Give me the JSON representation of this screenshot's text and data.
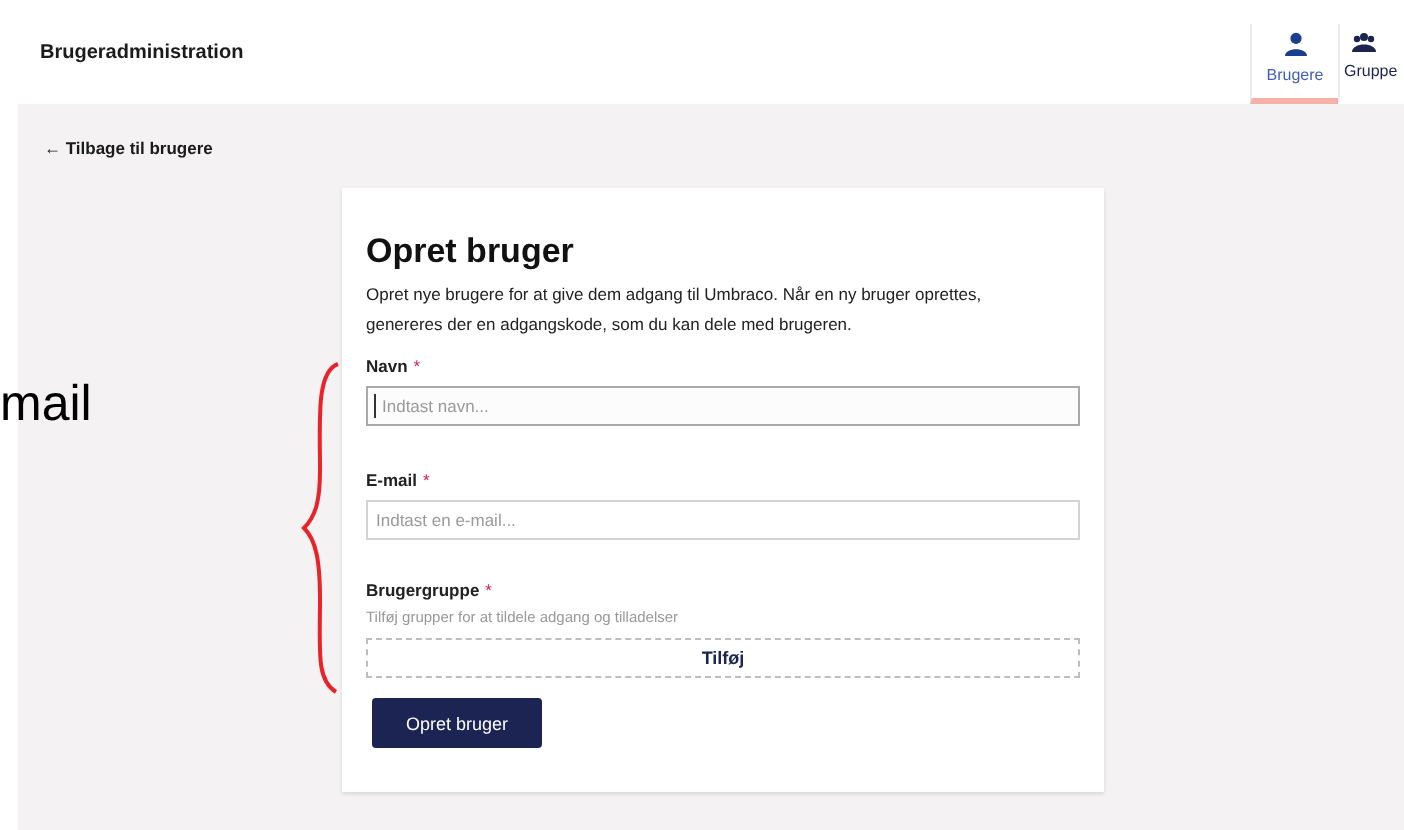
{
  "header": {
    "title": "Brugeradministration",
    "tabs": [
      {
        "label": "Brugere",
        "kind": "person",
        "selected": true
      },
      {
        "label": "Gruppe",
        "kind": "group",
        "selected": false
      }
    ]
  },
  "back_link": "← Tilbage til brugere",
  "form": {
    "title": "Opret bruger",
    "description": "Opret nye brugere for at give dem adgang til Umbraco. Når en ny bruger oprettes, genereres der en adgangskode, som du kan dele med brugeren.",
    "fields": [
      {
        "kind": "text",
        "label": "Navn",
        "required_mark": "*",
        "placeholder": "Indtast navn...",
        "focused": true
      },
      {
        "kind": "text",
        "label": "E-mail",
        "required_mark": "*",
        "placeholder": "Indtast en e-mail...",
        "focused": false
      },
      {
        "kind": "picker",
        "label": "Brugergruppe",
        "required_mark": "*",
        "hint": "Tilføj grupper for at tildele adgang og tilladelser",
        "button": "Tilføj"
      }
    ],
    "submit": "Opret bruger"
  },
  "annotation": {
    "text": "mail"
  }
}
